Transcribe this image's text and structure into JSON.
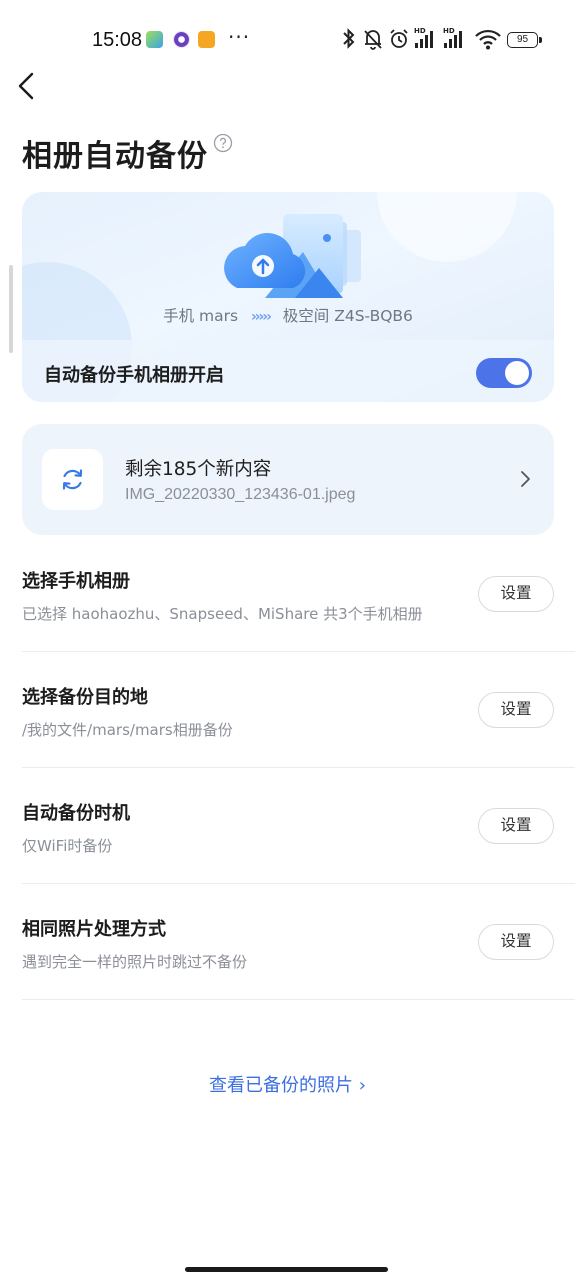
{
  "status_bar": {
    "time": "15:08",
    "notification_icons": [
      "app-green-icon",
      "app-purple-icon",
      "app-orange-icon"
    ],
    "more": "···",
    "hd1": "HD",
    "hd2": "HD",
    "battery": "95"
  },
  "header": {
    "title": "相册自动备份",
    "help_icon": "question-circle-icon"
  },
  "hero": {
    "source": "手机 mars",
    "arrows": "›››››",
    "destination": "极空间 Z4S-BQB6",
    "toggle_label": "自动备份手机相册开启",
    "toggle_on": true
  },
  "pending": {
    "title": "剩余185个新内容",
    "file": "IMG_20220330_123436-01.jpeg"
  },
  "settings": [
    {
      "title": "选择手机相册",
      "subtitle": "已选择 haohaozhu、Snapseed、MiShare 共3个手机相册",
      "button": "设置"
    },
    {
      "title": "选择备份目的地",
      "subtitle": "/我的文件/mars/mars相册备份",
      "button": "设置"
    },
    {
      "title": "自动备份时机",
      "subtitle": "仅WiFi时备份",
      "button": "设置"
    },
    {
      "title": "相同照片处理方式",
      "subtitle": "遇到完全一样的照片时跳过不备份",
      "button": "设置"
    }
  ],
  "footer": {
    "view_backed_up": "查看已备份的照片 ›"
  },
  "colors": {
    "accent": "#4d73e8",
    "link": "#3d6fe0",
    "card_bg": "#eef4fc"
  }
}
